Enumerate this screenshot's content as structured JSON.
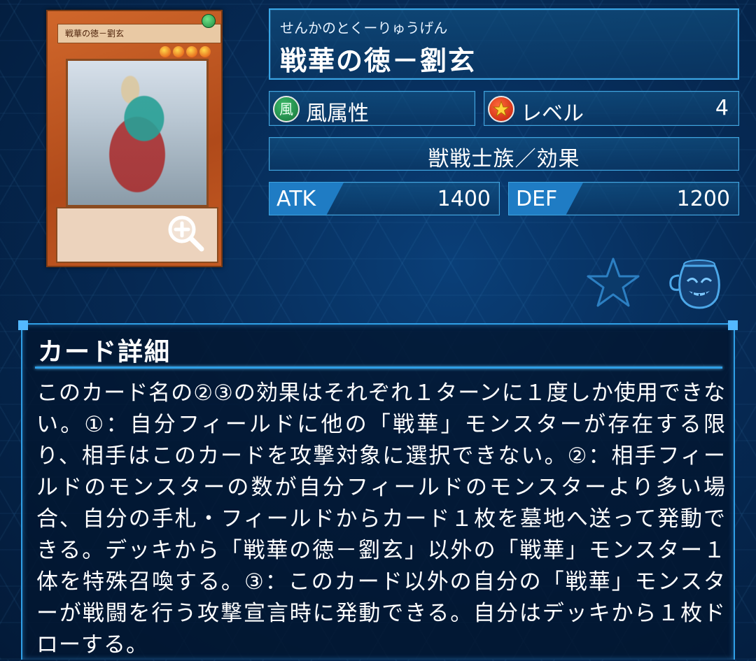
{
  "card": {
    "ruby": "せんかのとくーりゅうげん",
    "name": "戦華の徳－劉玄",
    "image_name_strip": "戦華の徳－劉玄",
    "attribute_glyph": "風",
    "attribute": "風属性",
    "level_label": "レベル",
    "level": "4",
    "type": "獣戦士族／効果",
    "atk_label": "ATK",
    "atk": "1400",
    "def_label": "DEF",
    "def": "1200"
  },
  "detail": {
    "heading": "カード詳細",
    "text": "このカード名の②③の効果はそれぞれ１ターンに１度しか使用できない。①：自分フィールドに他の「戦華」モンスターが存在する限り、相手はこのカードを攻撃対象に選択できない。②：相手フィールドのモンスターの数が自分フィールドのモンスターより多い場合、自分の手札・フィールドからカード１枚を墓地へ送って発動できる。デッキから「戦華の徳－劉玄」以外の「戦華」モンスター１体を特殊召喚する。③：このカード以外の自分の「戦華」モンスターが戦闘を行う攻撃宣言時に発動できる。自分はデッキから１枚ドローする。"
  },
  "icons": {
    "favorite": "star-icon",
    "deck": "pot-icon",
    "zoom": "magnifier-zoom-icon",
    "attribute": "wind-attribute-icon",
    "level": "level-star-icon"
  },
  "colors": {
    "panel_border": "#3ea5e0",
    "stat_tag": "#1f7cc4",
    "background": "#062a55"
  }
}
